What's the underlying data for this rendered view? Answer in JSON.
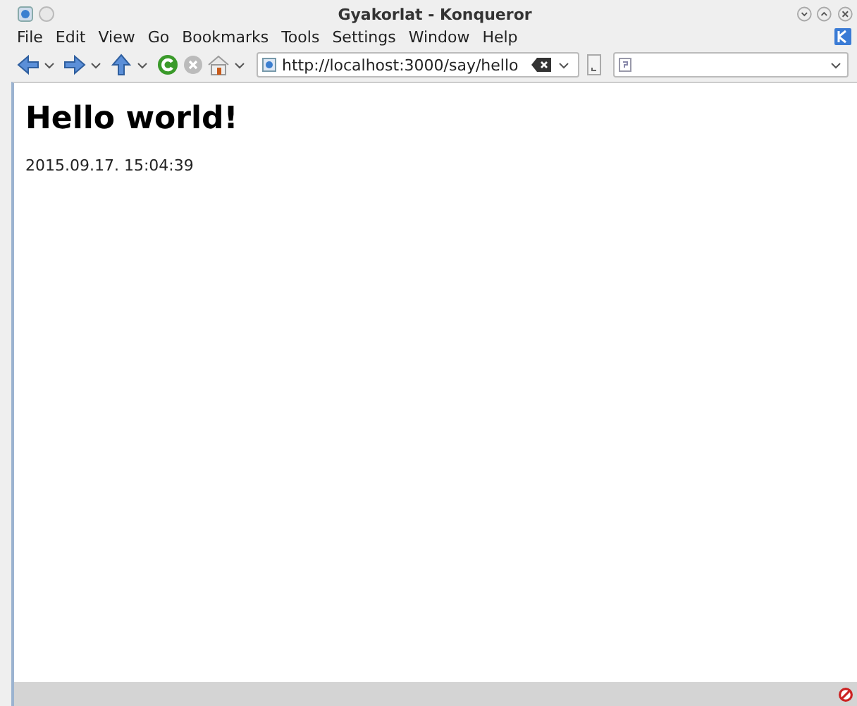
{
  "window": {
    "title": "Gyakorlat - Konqueror"
  },
  "menu": [
    "File",
    "Edit",
    "View",
    "Go",
    "Bookmarks",
    "Tools",
    "Settings",
    "Window",
    "Help"
  ],
  "toolbar": {
    "url": "http://localhost:3000/say/hello"
  },
  "page": {
    "heading": "Hello world!",
    "timestamp": "2015.09.17. 15:04:39"
  }
}
